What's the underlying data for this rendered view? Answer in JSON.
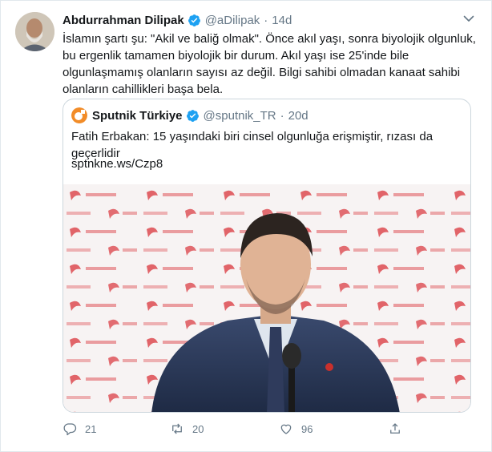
{
  "author": {
    "name": "Abdurrahman Dilipak",
    "handle": "@aDilipak",
    "separator": "·",
    "time": "14d"
  },
  "tweet_text": "İslamın şartı şu: \"Akil ve baliğ olmak\". Önce akıl yaşı, sonra biyolojik olgunluk,\nbu ergenlik tamamen biyolojik bir durum. Akıl yaşı ise 25'inde bile\nolgunlaşmamış olanların sayısı az değil. Bilgi sahibi olmadan kanaat sahibi\nolanların cahillikleri başa bela.",
  "quote": {
    "name": "Sputnik Türkiye",
    "handle": "@sputnik_TR",
    "separator": "·",
    "time": "20d",
    "text": "Fatih Erbakan: 15 yaşındaki biri cinsel olgunluğa erişmiştir, rızası da geçerlidir",
    "link": "sptnkne.ws/Czp8",
    "backdrop_text": "YENİDEN REFAH"
  },
  "actions": {
    "reply_count": "21",
    "retweet_count": "20",
    "like_count": "96"
  },
  "colors": {
    "verified_blue": "#1da1f2",
    "muted": "#657786",
    "border": "#ccd6dd",
    "backdrop_logo": "#d9343a"
  },
  "icons": [
    "verified-badge-icon",
    "chevron-down-icon",
    "reply-icon",
    "retweet-icon",
    "like-icon",
    "share-icon"
  ]
}
